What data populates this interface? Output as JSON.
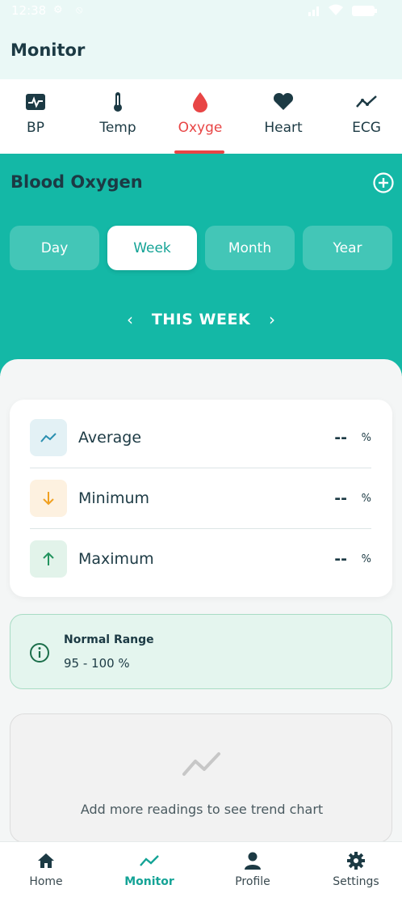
{
  "status_bar": {
    "time": "12:38",
    "left_icons": [
      "settings-icon",
      "do-not-disturb-icon"
    ],
    "right_icons": [
      "signal-icon",
      "wifi-icon",
      "battery-icon"
    ]
  },
  "app": {
    "title": "Monitor"
  },
  "tabs": [
    {
      "label": "BP",
      "icon": "bp-monitor-icon",
      "active": false
    },
    {
      "label": "Temp",
      "icon": "thermometer-icon",
      "active": false
    },
    {
      "label": "Oxyge",
      "icon": "drop-icon",
      "active": true
    },
    {
      "label": "Heart",
      "icon": "heart-icon",
      "active": false
    },
    {
      "label": "ECG",
      "icon": "ecg-trend-icon",
      "active": false
    }
  ],
  "hero": {
    "title": "Blood Oxygen",
    "periods": [
      {
        "label": "Day",
        "active": false
      },
      {
        "label": "Week",
        "active": true
      },
      {
        "label": "Month",
        "active": false
      },
      {
        "label": "Year",
        "active": false
      }
    ],
    "week_label": "THIS WEEK",
    "prev_glyph": "‹",
    "next_glyph": "›"
  },
  "stats": [
    {
      "label": "Average",
      "value": "--",
      "unit": "%",
      "icon": "trend-icon"
    },
    {
      "label": "Minimum",
      "value": "--",
      "unit": "%",
      "icon": "arrow-down-icon"
    },
    {
      "label": "Maximum",
      "value": "--",
      "unit": "%",
      "icon": "arrow-up-icon"
    }
  ],
  "normal_range": {
    "title": "Normal Range",
    "value": "95 - 100 %"
  },
  "chart_placeholder": {
    "message": "Add more readings to see trend chart"
  },
  "bottom_nav": [
    {
      "label": "Home",
      "icon": "home-icon",
      "active": false
    },
    {
      "label": "Monitor",
      "icon": "monitor-trend-icon",
      "active": true
    },
    {
      "label": "Profile",
      "icon": "person-icon",
      "active": false
    },
    {
      "label": "Settings",
      "icon": "gear-icon",
      "active": false
    }
  ],
  "colors": {
    "primary": "#14b8a6",
    "accent_red": "#e84545",
    "header_bg": "#eaf8f6",
    "text_dark": "#1c3a44",
    "range_bg": "#e4f5ee"
  }
}
